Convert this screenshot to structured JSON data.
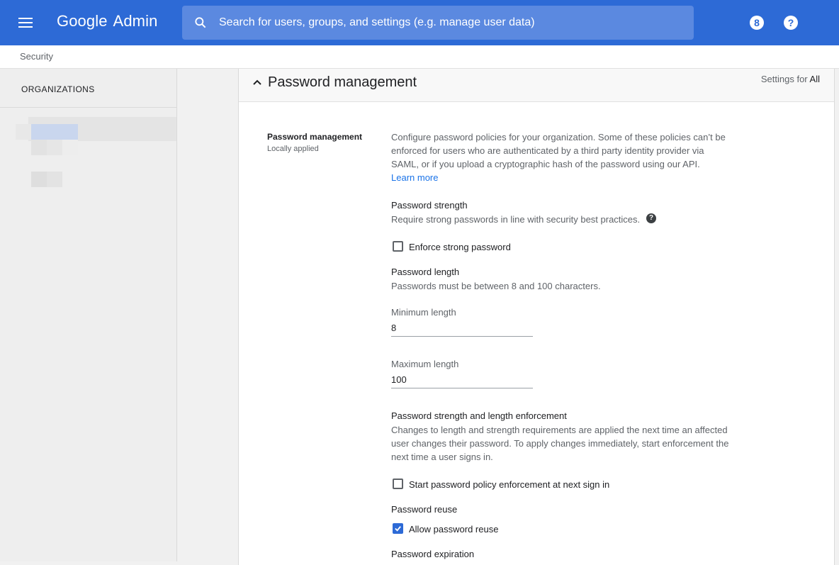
{
  "header": {
    "brand_google": "Google",
    "brand_product": "Admin",
    "search_placeholder": "Search for users, groups, and settings (e.g. manage user data)",
    "accent_color": "#2d6ad6"
  },
  "breadcrumb": {
    "current": "Security"
  },
  "sidebar": {
    "title": "ORGANIZATIONS"
  },
  "card": {
    "title": "Password management",
    "settings_for_label": "Settings for",
    "settings_for_value": "All",
    "section_label": "Password management",
    "section_status": "Locally applied",
    "description": "Configure password policies for your organization. Some of these policies can’t be enforced for users who are authenticated by a third party identity provider via SAML, or if you upload a cryptographic hash of the password using our API.",
    "learn_more": "Learn more",
    "strength": {
      "heading": "Password strength",
      "description": "Require strong passwords in line with security best practices.",
      "checkbox_label": "Enforce strong password",
      "checked": false
    },
    "length": {
      "heading": "Password length",
      "description": "Passwords must be between 8 and 100 characters.",
      "min_label": "Minimum length",
      "min_value": "8",
      "max_label": "Maximum length",
      "max_value": "100"
    },
    "enforcement": {
      "heading": "Password strength and length enforcement",
      "description": "Changes to length and strength requirements are applied the next time an affected user changes their password. To apply changes immediately, start enforcement the next time a user signs in.",
      "checkbox_label": "Start password policy enforcement at next sign in",
      "checked": false
    },
    "reuse": {
      "heading": "Password reuse",
      "checkbox_label": "Allow password reuse",
      "checked": true
    },
    "expiration": {
      "heading": "Password expiration"
    }
  }
}
